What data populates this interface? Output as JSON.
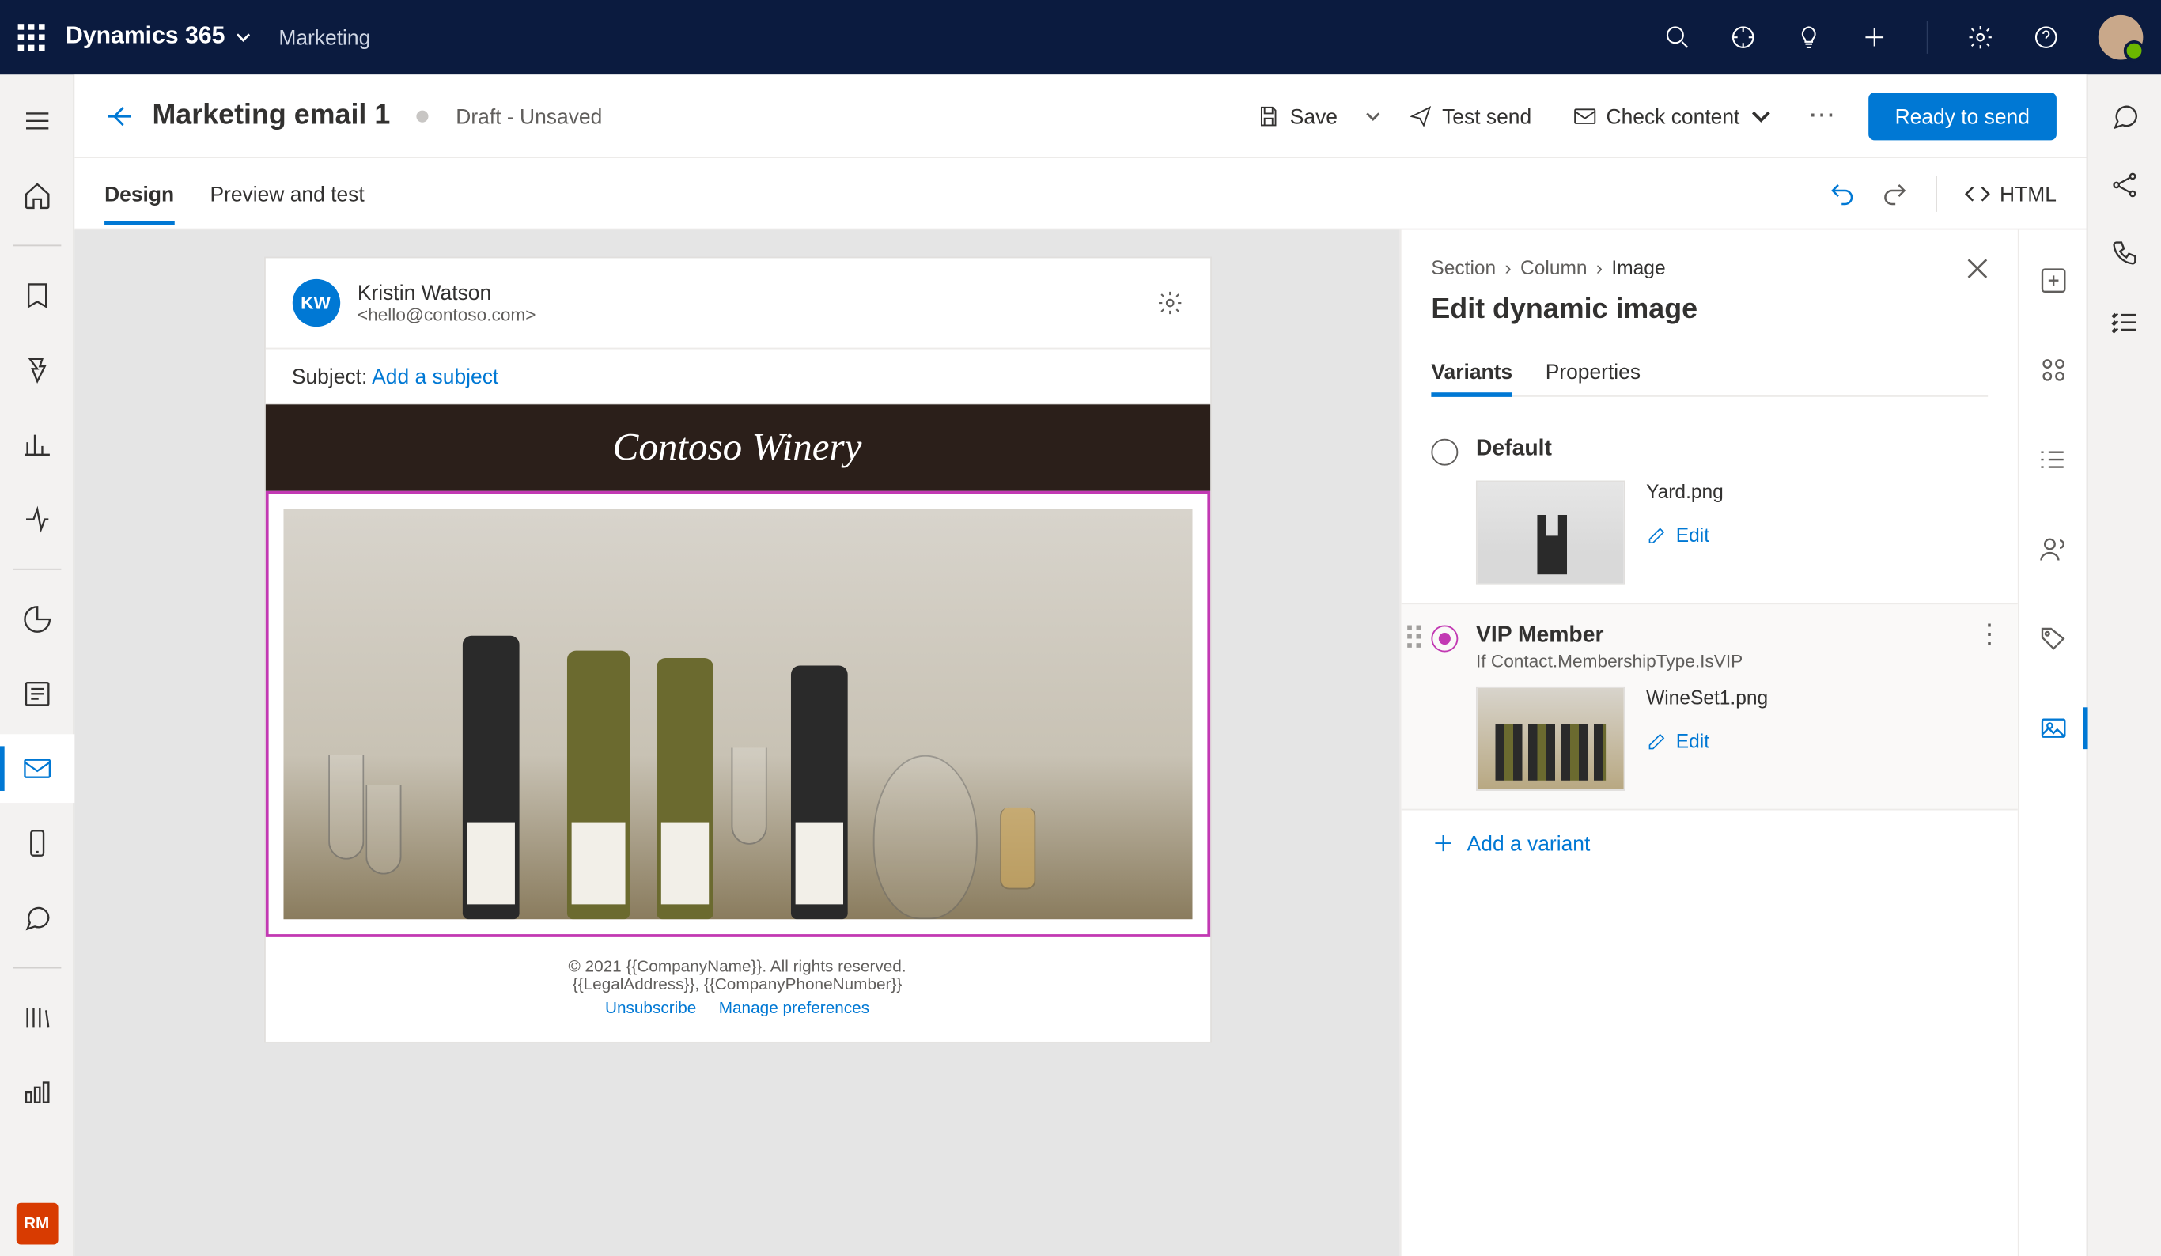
{
  "topbar": {
    "brand": "Dynamics 365",
    "area": "Marketing"
  },
  "rail_initials": "RM",
  "cmdbar": {
    "title": "Marketing email 1",
    "status": "Draft - Unsaved",
    "save": "Save",
    "test_send": "Test send",
    "check_content": "Check content",
    "ready": "Ready to send"
  },
  "tabs": {
    "design": "Design",
    "preview": "Preview and test",
    "html": "HTML"
  },
  "email": {
    "sender_initials": "KW",
    "sender_name": "Kristin Watson",
    "sender_email": "<hello@contoso.com>",
    "subject_label": "Subject: ",
    "subject_placeholder": "Add a subject",
    "brand_banner": "Contoso Winery",
    "footer_line1": "© 2021 {{CompanyName}}. All rights reserved.",
    "footer_line2": "{{LegalAddress}}, {{CompanyPhoneNumber}}",
    "unsubscribe": "Unsubscribe",
    "manage_prefs": "Manage preferences"
  },
  "panel": {
    "crumb_section": "Section",
    "crumb_column": "Column",
    "crumb_image": "Image",
    "title": "Edit dynamic image",
    "tab_variants": "Variants",
    "tab_properties": "Properties",
    "edit": "Edit",
    "add_variant": "Add a variant",
    "variants": [
      {
        "name": "Default",
        "file": "Yard.png",
        "selected": false,
        "condition": ""
      },
      {
        "name": "VIP Member",
        "file": "WineSet1.png",
        "selected": true,
        "condition": "If Contact.MembershipType.IsVIP"
      }
    ]
  }
}
